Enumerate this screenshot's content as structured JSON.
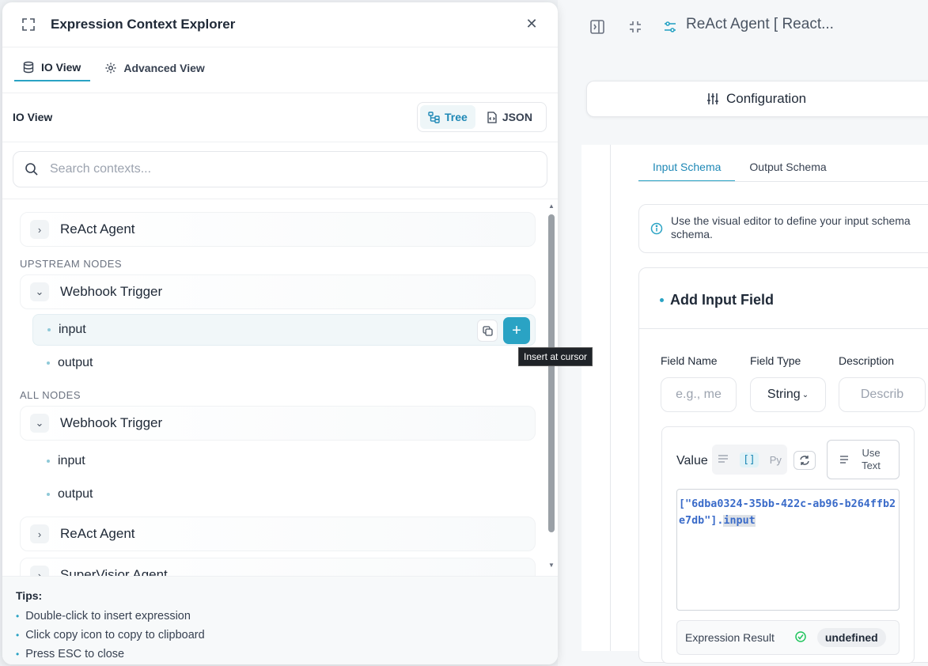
{
  "explorer": {
    "title": "Expression Context Explorer",
    "tabs": [
      {
        "label": "IO View",
        "icon": "database-icon",
        "active": true
      },
      {
        "label": "Advanced View",
        "icon": "gear-icon",
        "active": false
      }
    ],
    "section_label": "IO View",
    "view_toggle": [
      {
        "label": "Tree",
        "icon": "tree-icon",
        "active": true
      },
      {
        "label": "JSON",
        "icon": "file-code-icon",
        "active": false
      }
    ],
    "search_placeholder": "Search contexts...",
    "tree": {
      "top_node": "ReAct Agent",
      "upstream_label": "UPSTREAM NODES",
      "upstream_node": "Webhook Trigger",
      "upstream_children": [
        "input",
        "output"
      ],
      "all_label": "ALL NODES",
      "all_node": "Webhook Trigger",
      "all_children": [
        "input",
        "output"
      ],
      "more_nodes": [
        "ReAct Agent",
        "SuperVisior Agent"
      ]
    },
    "tooltip": "Insert at cursor",
    "tips": {
      "title": "Tips:",
      "items": [
        "Double-click to insert expression",
        "Click copy icon to copy to clipboard",
        "Press ESC to close"
      ]
    }
  },
  "background": {
    "title": "ReAct Agent [ React...",
    "config_label": "Configuration",
    "schema_tabs": [
      {
        "label": "Input Schema",
        "active": true
      },
      {
        "label": "Output Schema",
        "active": false
      }
    ],
    "info_text": "Use the visual editor to define your input schema schema.",
    "add_title": "Add Input Field",
    "field_labels": {
      "name": "Field Name",
      "type": "Field Type",
      "description": "Description"
    },
    "field_name_placeholder": "e.g., me",
    "field_type_value": "String",
    "description_placeholder": "Describ",
    "value_label": "Value",
    "mode_py": "Py",
    "use_text_label": "Use Text",
    "code": "[\"6dba0324-35bb-422c-ab96-b264ffb2e7db\"].",
    "code_highlight": "input",
    "result_label": "Expression Result",
    "result_value": "undefined"
  },
  "colors": {
    "accent": "#2aa3c4",
    "code": "#3a6bc9"
  }
}
